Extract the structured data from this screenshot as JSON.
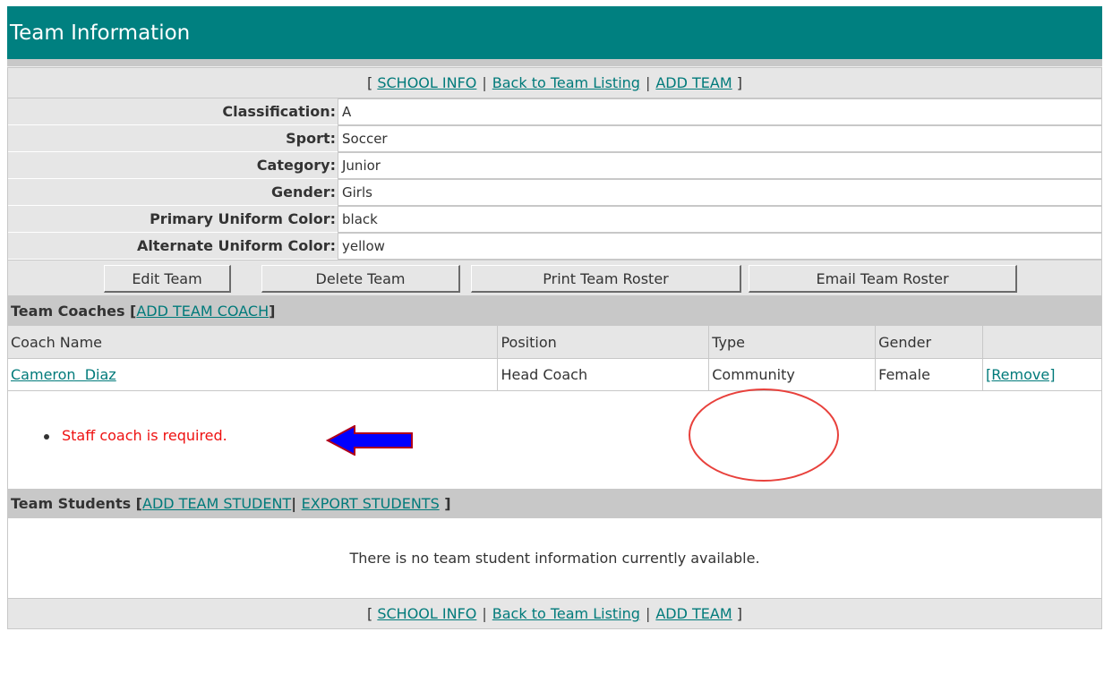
{
  "page": {
    "title": "Team Information"
  },
  "links": {
    "school_info": "SCHOOL INFO",
    "back_to_listing": "Back to Team Listing",
    "add_team": "ADD TEAM"
  },
  "team_info": [
    {
      "label": "Classification:",
      "value": "A"
    },
    {
      "label": "Sport:",
      "value": "Soccer"
    },
    {
      "label": "Category:",
      "value": "Junior"
    },
    {
      "label": "Gender:",
      "value": "Girls"
    },
    {
      "label": "Primary Uniform Color:",
      "value": "black"
    },
    {
      "label": "Alternate Uniform Color:",
      "value": "yellow"
    }
  ],
  "actions": {
    "edit_team": "Edit Team",
    "delete_team": "Delete Team",
    "print_roster": "Print Team Roster",
    "email_roster": "Email Team Roster"
  },
  "coaches": {
    "heading": "Team Coaches",
    "add_link": "ADD TEAM COACH",
    "columns": [
      "Coach Name",
      "Position",
      "Type",
      "Gender",
      ""
    ],
    "rows": [
      {
        "name": "Cameron  Diaz",
        "position": "Head Coach",
        "type": "Community",
        "gender": "Female",
        "action": "[Remove]"
      }
    ],
    "error": "Staff coach is required."
  },
  "students": {
    "heading": "Team Students",
    "add_link": "ADD TEAM STUDENT",
    "export_link": "EXPORT STUDENTS",
    "empty_message": "There is no team student information currently available."
  },
  "colors": {
    "header_teal": "#008080",
    "link_teal": "#007a7a",
    "error_red": "#ee1111",
    "arrow_blue": "#0000ff"
  },
  "icons": {
    "error_arrow": "left-arrow-icon",
    "highlight": "circle-highlight"
  }
}
